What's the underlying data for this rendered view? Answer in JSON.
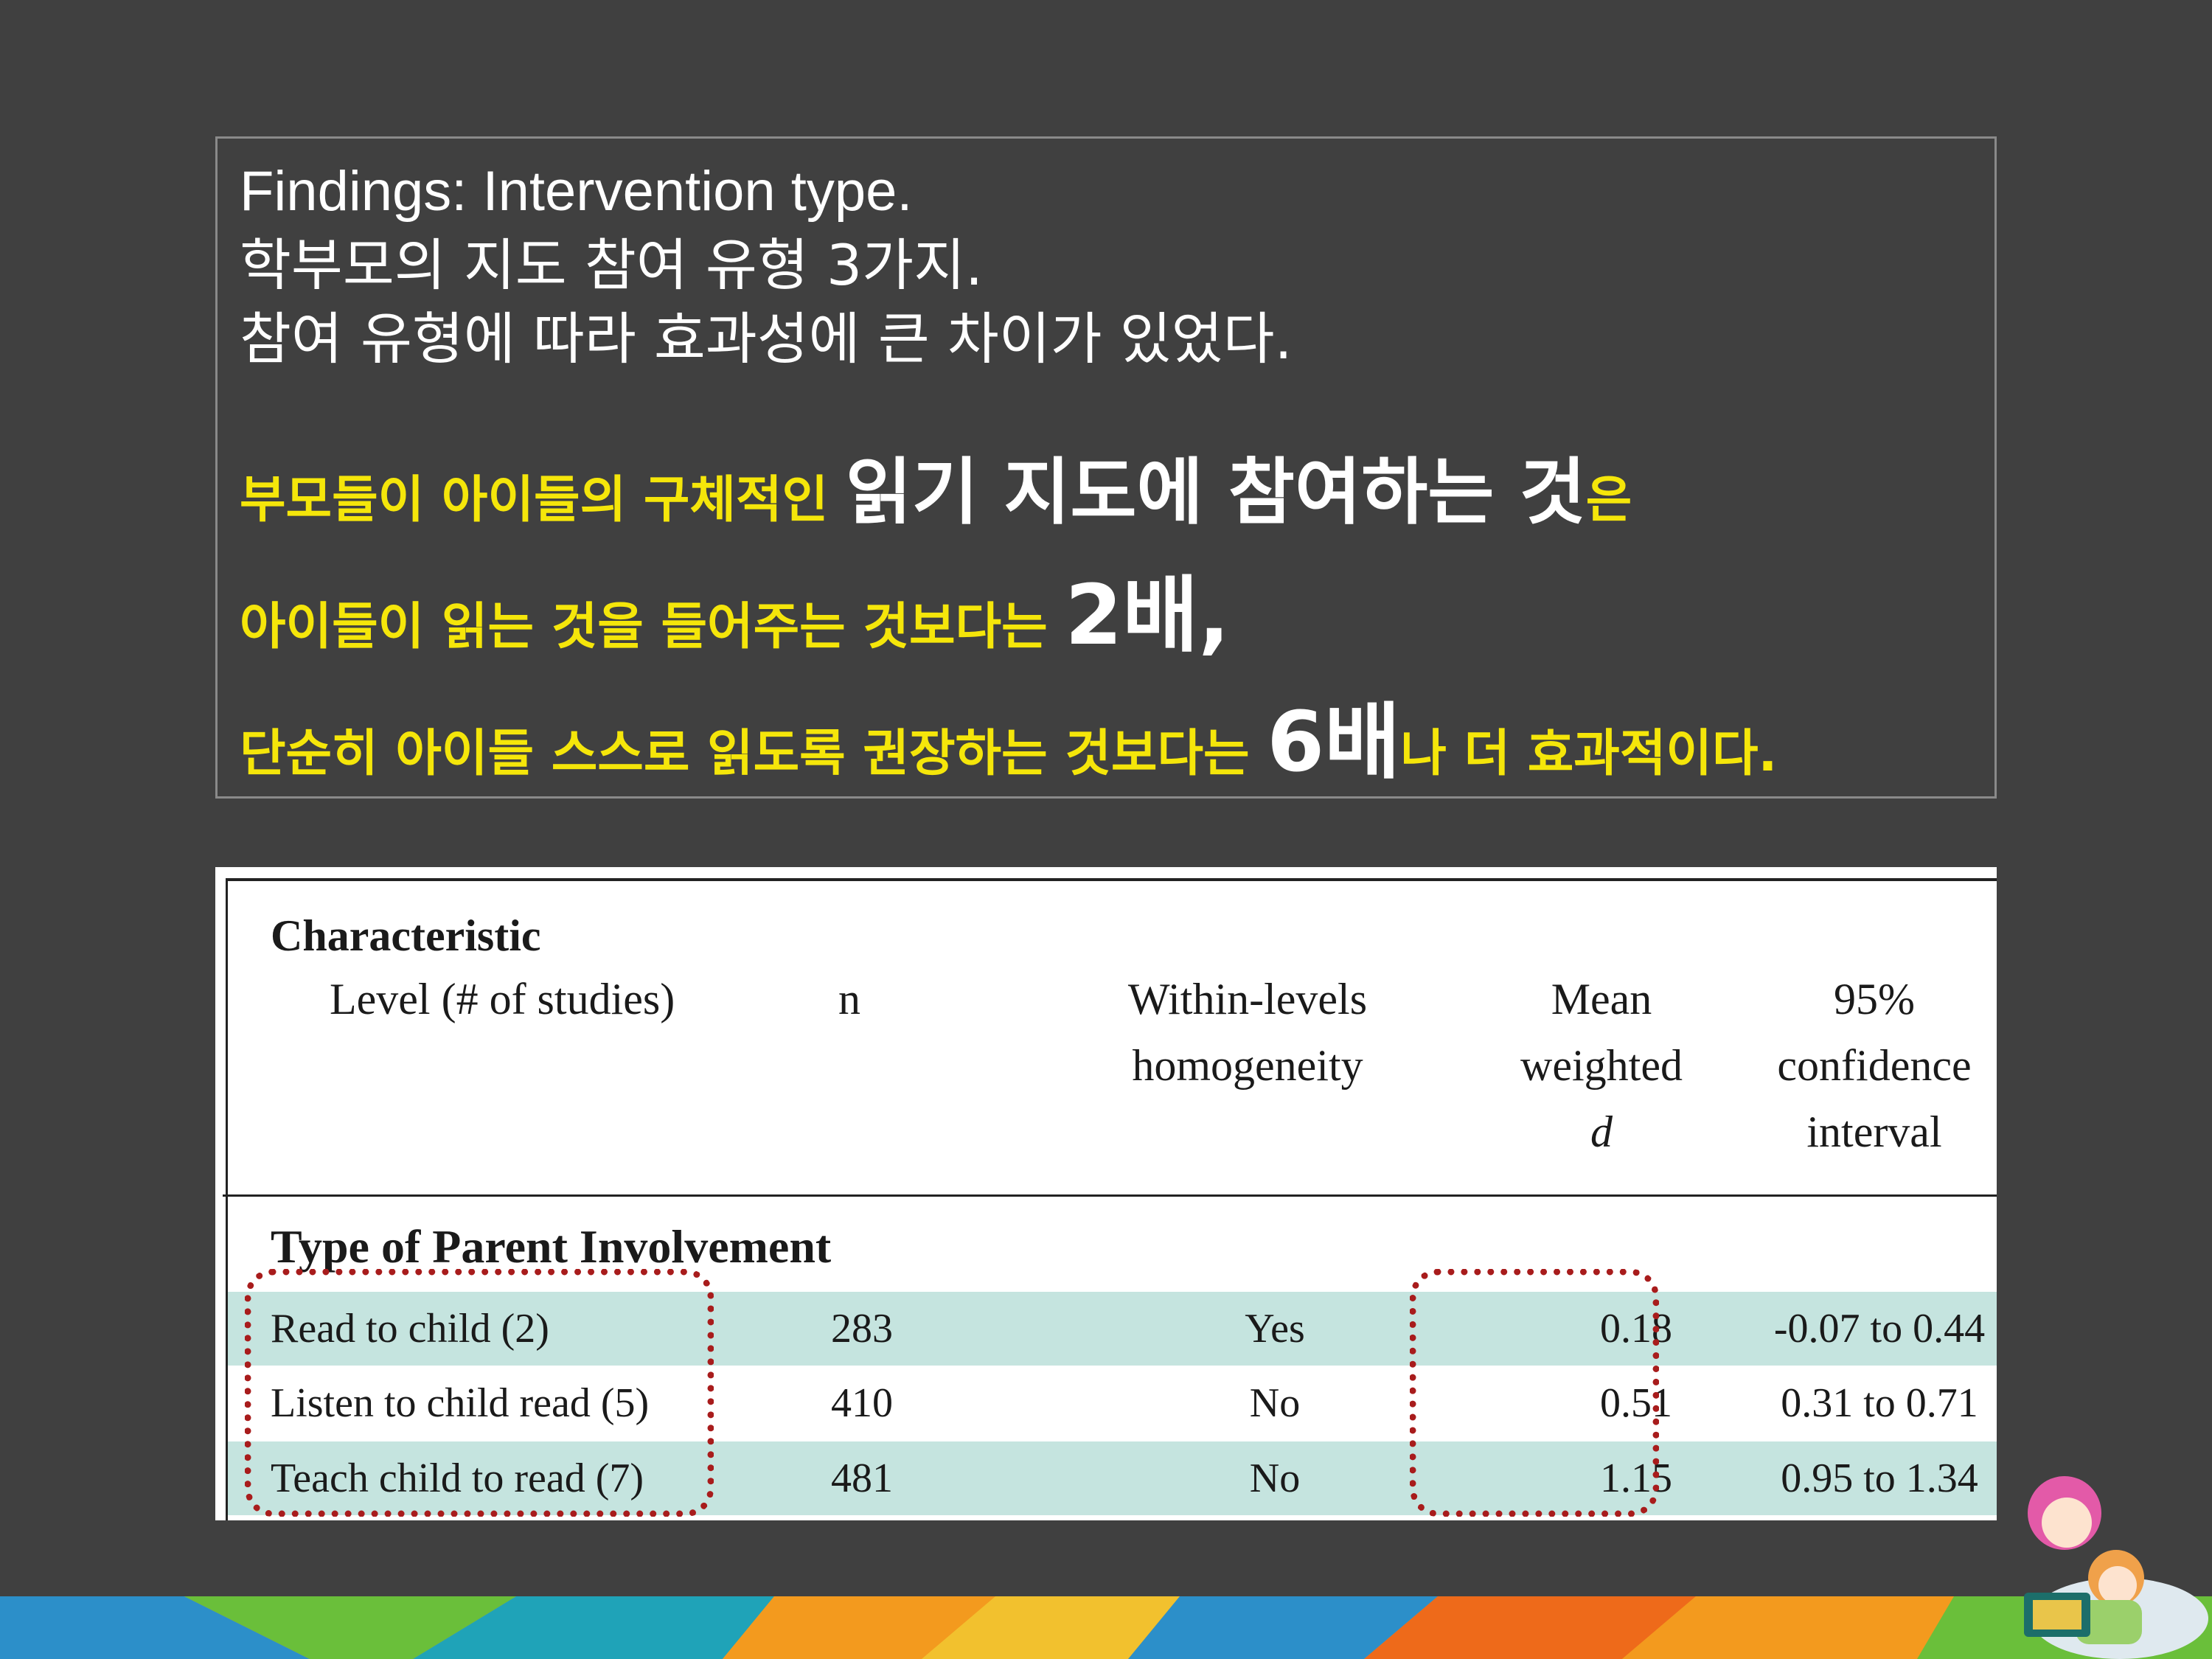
{
  "slide": {
    "title": "Findings: Intervention type.",
    "line2": "학부모의 지도 참여 유형 3가지.",
    "line3": "참여 유형에 따라 효과성에 큰 차이가 있었다.",
    "emphasis": {
      "l1_a": "부모들이 아이들의 구체적인 ",
      "l1_big": "읽기 지도에 참여하는 것",
      "l1_b": "은",
      "l2_a": "아이들이 읽는 것을 들어주는 것보다는 ",
      "l2_big": "2배,",
      "l3_a": "단순히 아이들 스스로 읽도록 권장하는 것보다는 ",
      "l3_big": "6배",
      "l3_b": "나 더 효과적이다."
    }
  },
  "table": {
    "header": {
      "characteristic": "Characteristic",
      "level": "Level (# of studies)",
      "n": "n",
      "homogeneity_1": "Within-levels",
      "homogeneity_2": "homogeneity",
      "mean_1": "Mean",
      "mean_2": "weighted",
      "mean_3": "d",
      "ci_1": "95%",
      "ci_2": "confidence",
      "ci_3": "interval"
    },
    "section": "Type of Parent Involvement",
    "rows": [
      {
        "level": "Read to child (2)",
        "n": "283",
        "homogeneity": "Yes",
        "mean_d": "0.18",
        "ci": "-0.07 to 0.44"
      },
      {
        "level": "Listen to child read (5)",
        "n": "410",
        "homogeneity": "No",
        "mean_d": "0.51",
        "ci": "0.31 to 0.71"
      },
      {
        "level": "Teach child to read (7)",
        "n": "481",
        "homogeneity": "No",
        "mean_d": "1.15",
        "ci": "0.95 to 1.34"
      }
    ]
  },
  "colors": {
    "background": "#404040",
    "emphasis_yellow": "#f5e60a",
    "row_shade": "#c5e4df",
    "highlight_dots": "#a81c1c"
  }
}
